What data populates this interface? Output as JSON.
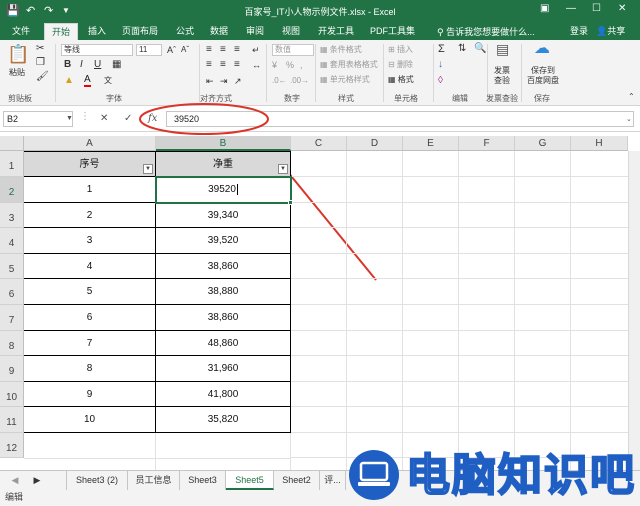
{
  "app": {
    "title": "百家号_IT小人物示例文件.xlsx - Excel",
    "login": "登录",
    "share": "共享",
    "tell_me": "告诉我您想要做什么...",
    "accent_color": "#217346"
  },
  "ribbon_tabs": [
    "文件",
    "开始",
    "插入",
    "页面布局",
    "公式",
    "数据",
    "审阅",
    "视图",
    "开发工具",
    "PDF工具集"
  ],
  "ribbon": {
    "paste": "粘贴",
    "font_name": "等线",
    "font_size": "11",
    "number_format": "数值",
    "conditional_format": "条件格式",
    "table_format": "套用表格格式",
    "cell_style": "单元格样式",
    "insert": "插入",
    "delete": "删除",
    "format": "格式",
    "publish_line1": "发票",
    "publish_line2": "查验",
    "save_baidu_line1": "保存到",
    "save_baidu_line2": "百度网盘",
    "groups": [
      "剪贴板",
      "字体",
      "对齐方式",
      "数字",
      "样式",
      "单元格",
      "编辑",
      "发票查验",
      "保存"
    ]
  },
  "formula_bar": {
    "name_box": "B2",
    "fx": "fx",
    "value": "39520"
  },
  "columns": [
    "A",
    "B",
    "C",
    "D",
    "E",
    "F",
    "G",
    "H"
  ],
  "rows": [
    "1",
    "2",
    "3",
    "4",
    "5",
    "6",
    "7",
    "8",
    "9",
    "10",
    "11",
    "12"
  ],
  "table": {
    "headers": [
      "序号",
      "净重"
    ],
    "rows": [
      [
        "1",
        "39520"
      ],
      [
        "2",
        "39,340"
      ],
      [
        "3",
        "39,520"
      ],
      [
        "4",
        "38,860"
      ],
      [
        "5",
        "38,880"
      ],
      [
        "6",
        "38,860"
      ],
      [
        "7",
        "48,860"
      ],
      [
        "8",
        "31,960"
      ],
      [
        "9",
        "41,800"
      ],
      [
        "10",
        "35,820"
      ]
    ]
  },
  "sheet_tabs": [
    "Sheet3 (2)",
    "员工信息",
    "Sheet3",
    "Sheet5",
    "Sheet2",
    "评..."
  ],
  "active_sheet": "Sheet5",
  "status": "编辑",
  "watermark": "电脑知识吧"
}
